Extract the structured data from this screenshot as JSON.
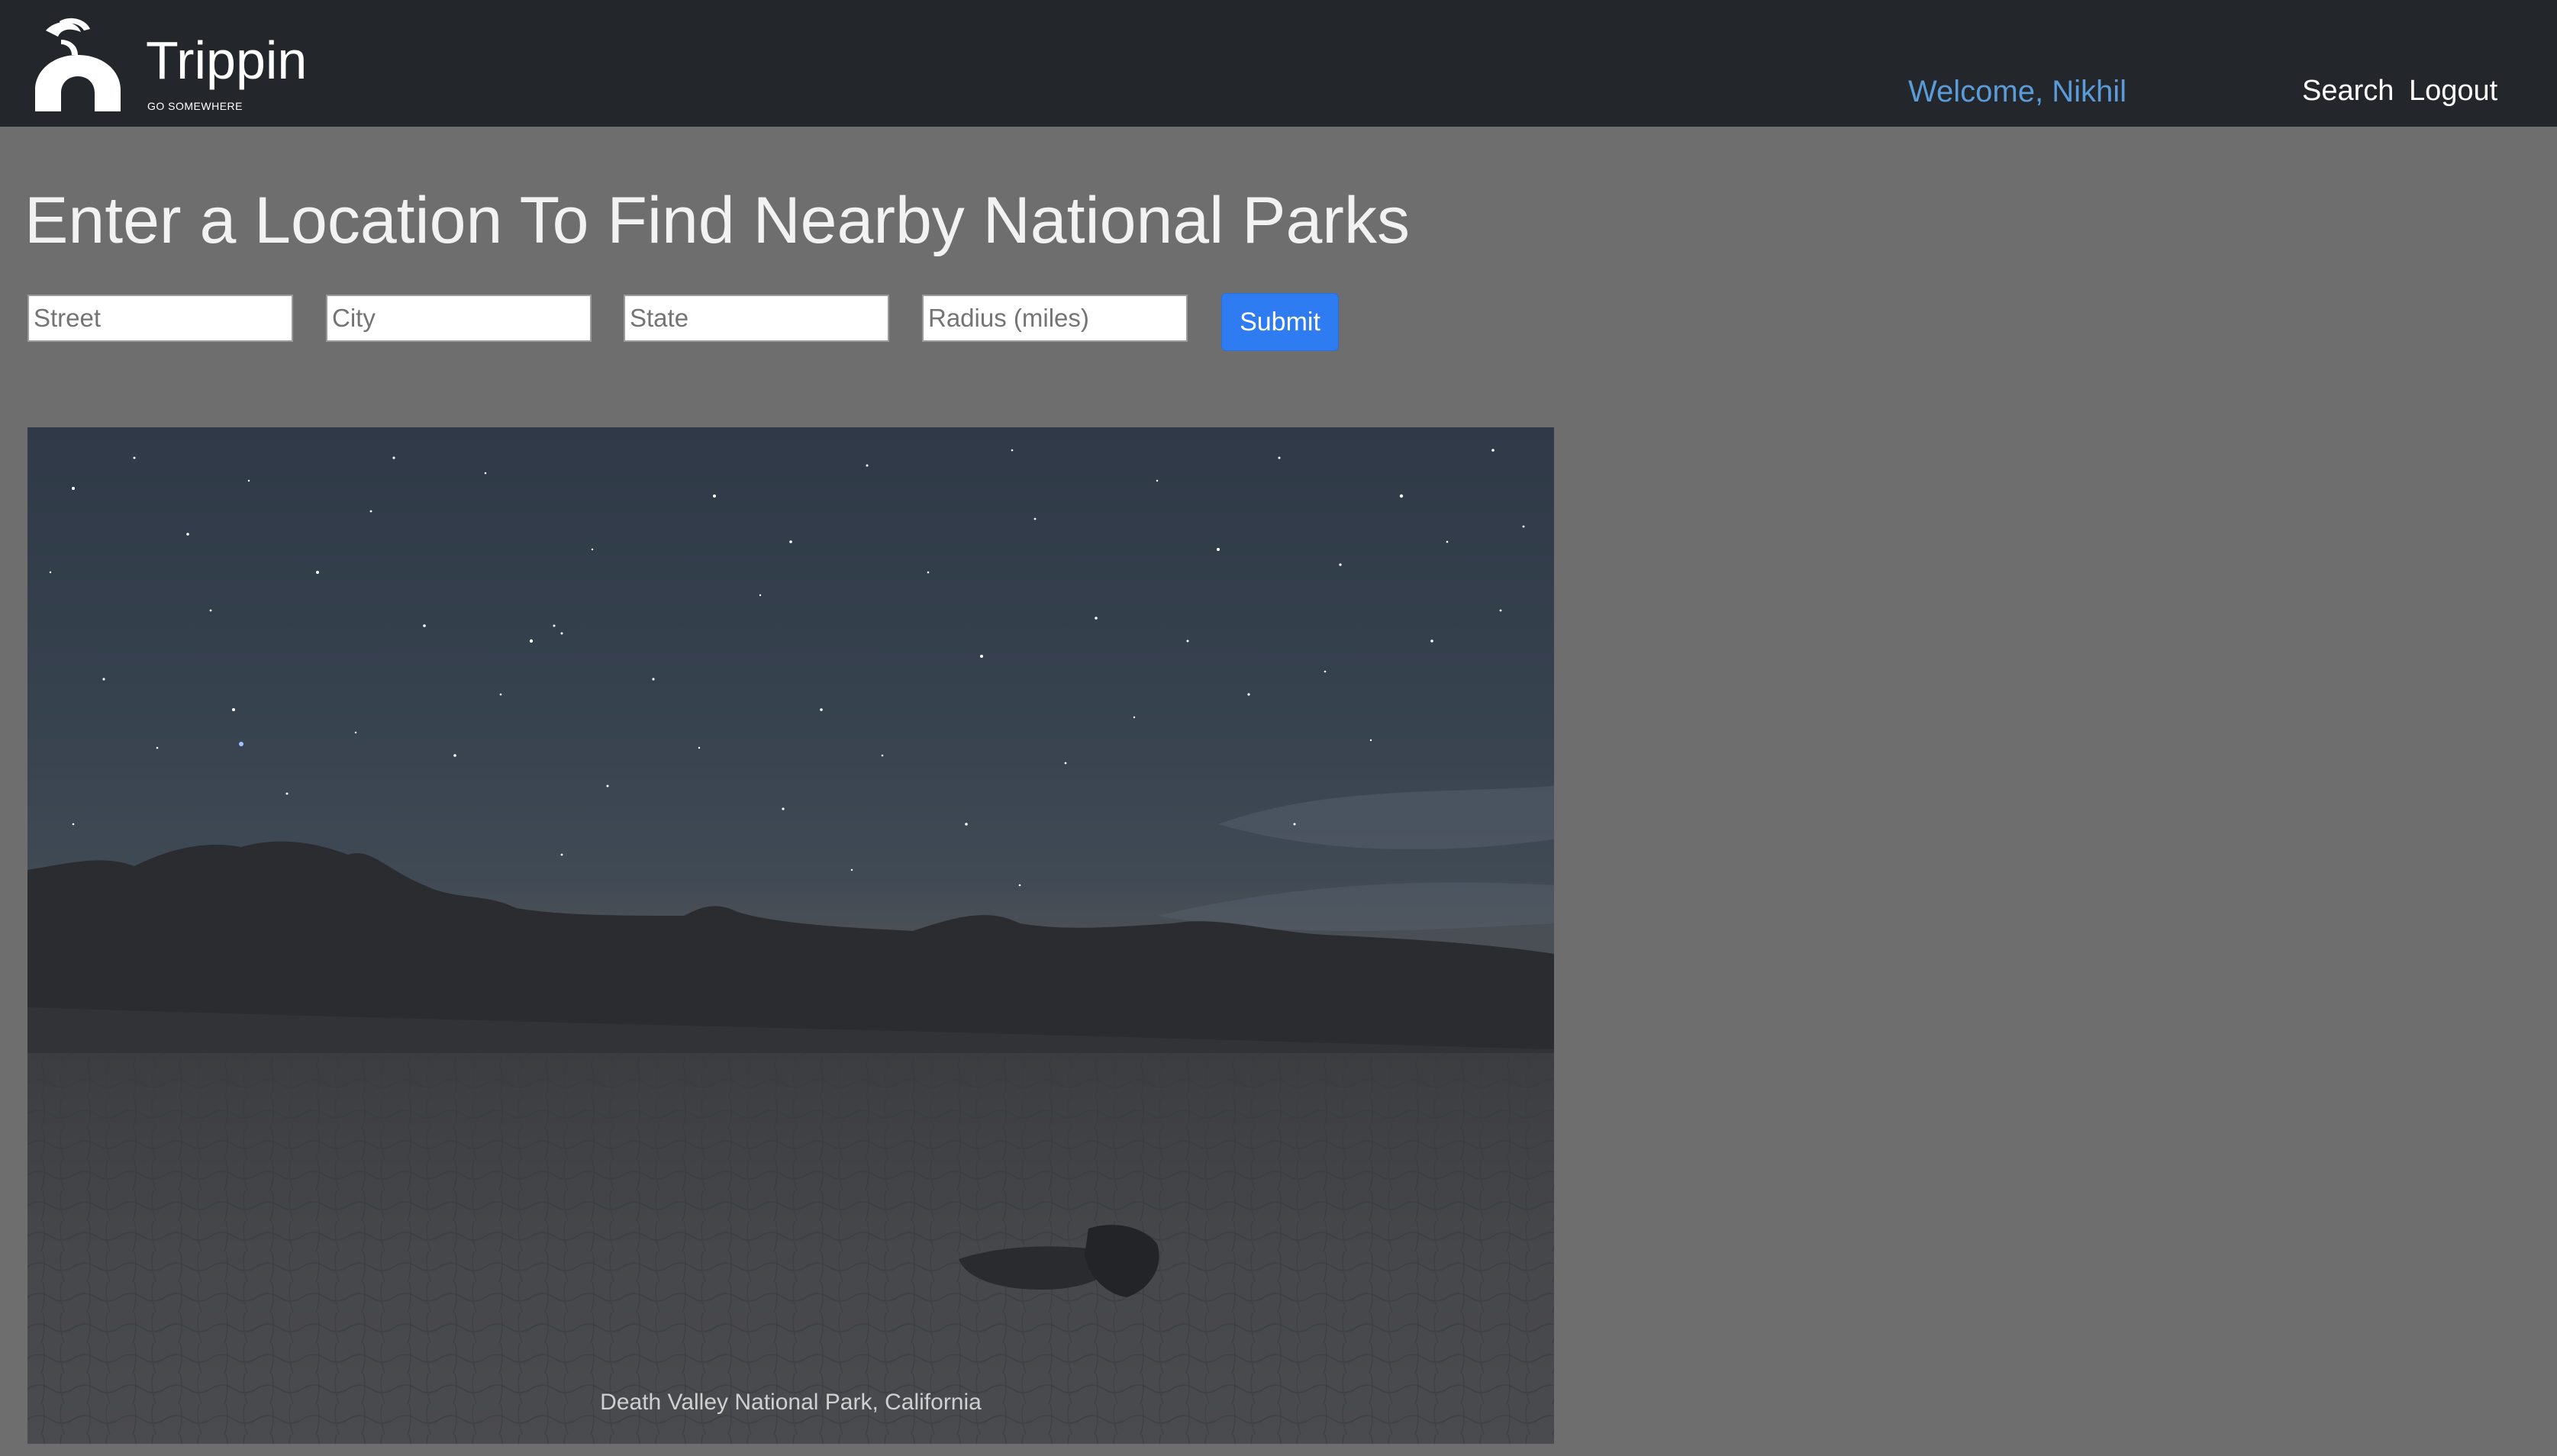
{
  "header": {
    "brand_name": "Trippin",
    "brand_tagline": "GO SOMEWHERE",
    "logo_icon": "road-logo-icon",
    "welcome_text": "Welcome, Nikhil",
    "nav": {
      "search_label": "Search",
      "logout_label": "Logout"
    }
  },
  "main": {
    "title": "Enter a Location To Find Nearby National Parks",
    "form": {
      "street_placeholder": "Street",
      "city_placeholder": "City",
      "state_placeholder": "State",
      "radius_placeholder": "Radius (miles)",
      "street_value": "",
      "city_value": "",
      "state_value": "",
      "radius_value": "",
      "submit_label": "Submit"
    },
    "hero": {
      "caption": "Death Valley National Park, California"
    }
  },
  "colors": {
    "navbar_bg": "#23272c",
    "page_bg": "#6e6e6e",
    "accent_blue": "#2e7bf2",
    "welcome_blue": "#5b9bd8"
  }
}
